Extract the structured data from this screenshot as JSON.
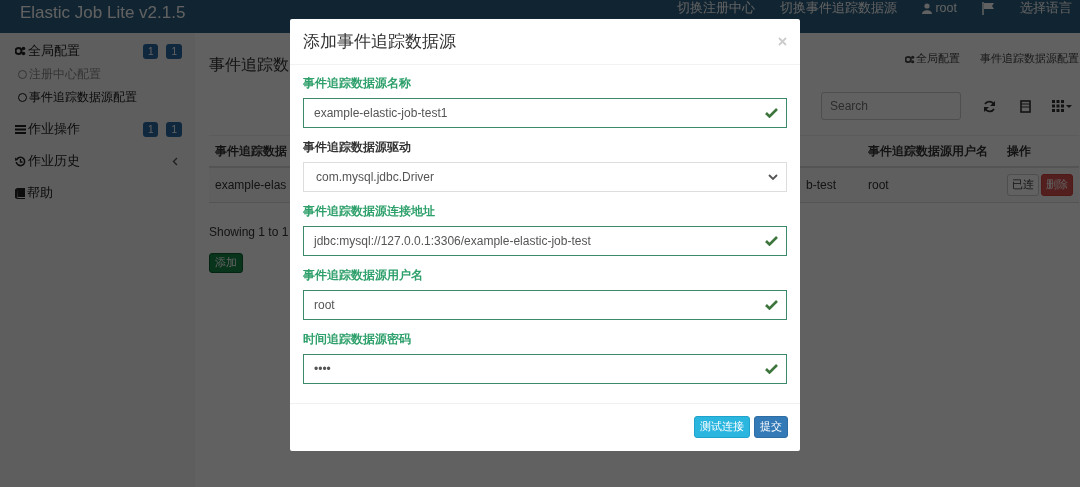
{
  "navbar": {
    "brand": "Elastic Job Lite v2.1.5",
    "items": [
      {
        "kind": "link",
        "label": "切换注册中心"
      },
      {
        "kind": "link",
        "label": "切换事件追踪数据源"
      },
      {
        "kind": "user",
        "label": "root"
      },
      {
        "kind": "flag"
      },
      {
        "kind": "link",
        "label": "选择语言"
      }
    ]
  },
  "sidebar": {
    "items": [
      {
        "label": "全局配置",
        "badges": [
          "1",
          "1"
        ],
        "submenu": false,
        "children": [
          {
            "label": "注册中心配置",
            "selected": false
          },
          {
            "label": "事件追踪数据源配置",
            "selected": true
          }
        ]
      },
      {
        "label": "作业操作",
        "badges": [
          "1",
          "1"
        ],
        "submenu": false
      },
      {
        "label": "作业历史",
        "submenu": true
      },
      {
        "label": "帮助",
        "submenu": false
      }
    ]
  },
  "page": {
    "title": "事件追踪数",
    "breadcrumb": [
      "全局配置",
      "事件追踪数据源配置"
    ],
    "search": {
      "placeholder": "Search"
    },
    "table": {
      "columns": [
        "事件追踪数据",
        "",
        "事件追踪数据源用户名",
        "操作"
      ],
      "rows": [
        {
          "cells": [
            "example-elas",
            "b-test",
            "root"
          ],
          "actions": [
            {
              "kind": "default",
              "label": "已连"
            },
            {
              "kind": "danger",
              "label": "删除"
            }
          ]
        }
      ]
    },
    "showing": "Showing 1 to 1",
    "add_button": "添加"
  },
  "modal": {
    "title": "添加事件追踪数据源",
    "fields": [
      {
        "kind": "text",
        "label": "事件追踪数据源名称",
        "value": "example-elastic-job-test1",
        "valid": true
      },
      {
        "kind": "select",
        "label": "事件追踪数据源驱动",
        "value": "com.mysql.jdbc.Driver",
        "valid": false
      },
      {
        "kind": "text",
        "label": "事件追踪数据源连接地址",
        "value": "jdbc:mysql://127.0.0.1:3306/example-elastic-job-test",
        "valid": true
      },
      {
        "kind": "text",
        "label": "事件追踪数据源用户名",
        "value": "root",
        "valid": true
      },
      {
        "kind": "text",
        "label": "时间追踪数据源密码",
        "value": "••••",
        "valid": true
      }
    ],
    "buttons": [
      {
        "kind": "info",
        "label": "测试连接"
      },
      {
        "kind": "primary",
        "label": "提交"
      }
    ]
  }
}
